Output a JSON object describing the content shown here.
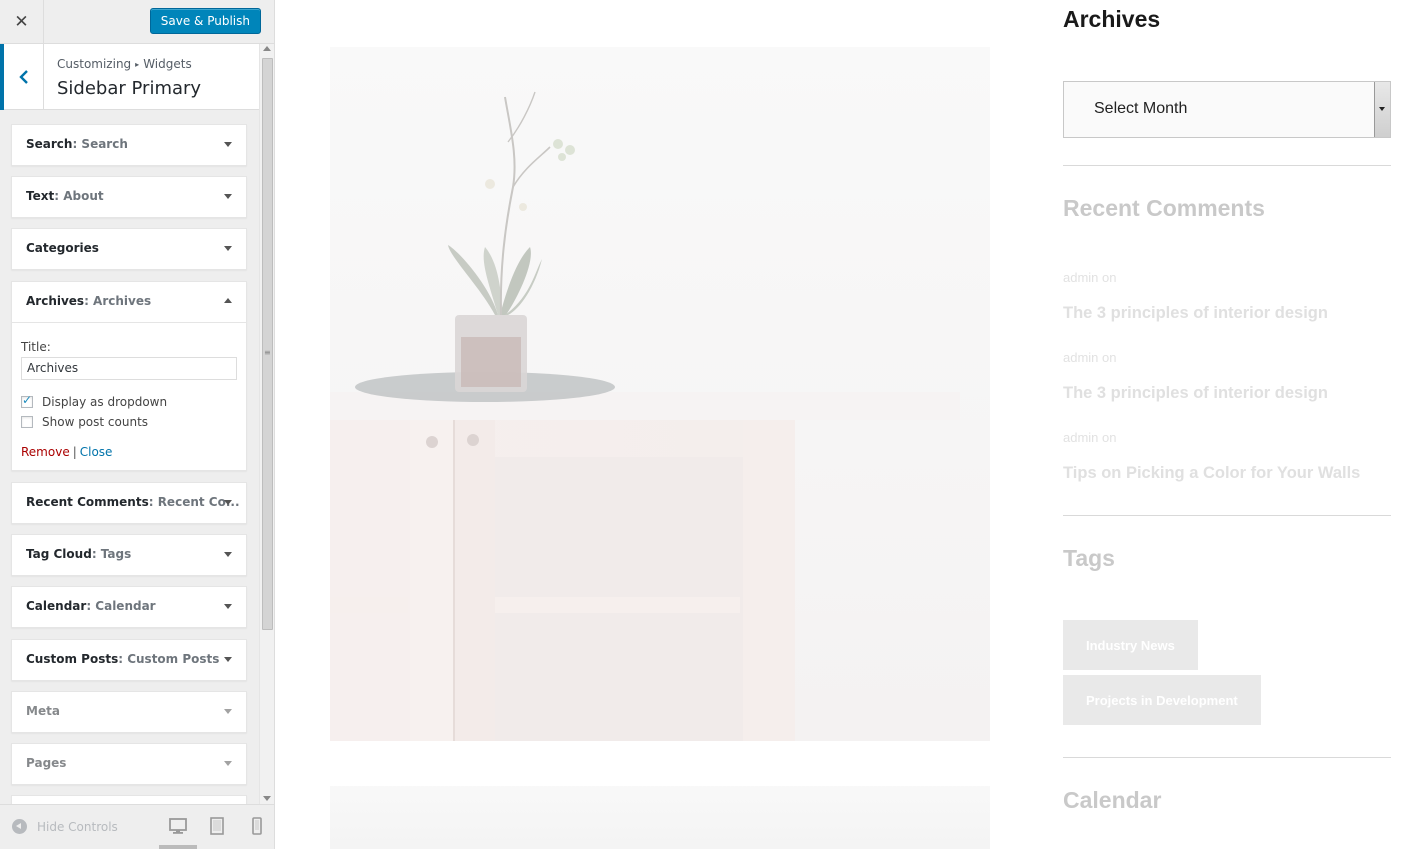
{
  "topbar": {
    "close_icon": "close-icon",
    "publish_label": "Save & Publish"
  },
  "section": {
    "breadcrumb_root": "Customizing",
    "breadcrumb_leaf": "Widgets",
    "title": "Sidebar Primary"
  },
  "widgets": [
    {
      "name": "Search",
      "subtitle": ": Search",
      "expanded": false
    },
    {
      "name": "Text",
      "subtitle": ": About",
      "expanded": false
    },
    {
      "name": "Categories",
      "subtitle": "",
      "expanded": false
    },
    {
      "name": "Archives",
      "subtitle": ": Archives",
      "expanded": true
    },
    {
      "name": "Recent Comments",
      "subtitle": ": Recent Co...",
      "expanded": false
    },
    {
      "name": "Tag Cloud",
      "subtitle": ": Tags",
      "expanded": false
    },
    {
      "name": "Calendar",
      "subtitle": ": Calendar",
      "expanded": false
    },
    {
      "name": "Custom Posts",
      "subtitle": ": Custom Posts",
      "expanded": false
    },
    {
      "name": "Meta",
      "subtitle": "",
      "expanded": false
    },
    {
      "name": "Pages",
      "subtitle": "",
      "expanded": false
    }
  ],
  "archives_form": {
    "title_label": "Title:",
    "title_value": "Archives",
    "dropdown_label": "Display as dropdown",
    "dropdown_checked": true,
    "counts_label": "Show post counts",
    "counts_checked": false,
    "remove_label": "Remove",
    "separator": "|",
    "close_label": "Close"
  },
  "footer": {
    "hide_controls": "Hide Controls",
    "devices": [
      "desktop-icon",
      "tablet-icon",
      "mobile-icon"
    ]
  },
  "preview": {
    "archives_title": "Archives",
    "select_month": "Select Month",
    "recent_comments_title": "Recent Comments",
    "comments": [
      {
        "meta": "admin on",
        "post": "The 3 principles of interior design"
      },
      {
        "meta": "admin on",
        "post": "The 3 principles of interior design"
      },
      {
        "meta": "admin on",
        "post": "Tips on Picking a Color for Your Walls"
      }
    ],
    "tags_title": "Tags",
    "tags": [
      "Industry News",
      "Projects in Development"
    ],
    "calendar_title": "Calendar"
  },
  "colors": {
    "accent": "#0085ba",
    "link": "#0073aa",
    "remove": "#aa0000"
  }
}
